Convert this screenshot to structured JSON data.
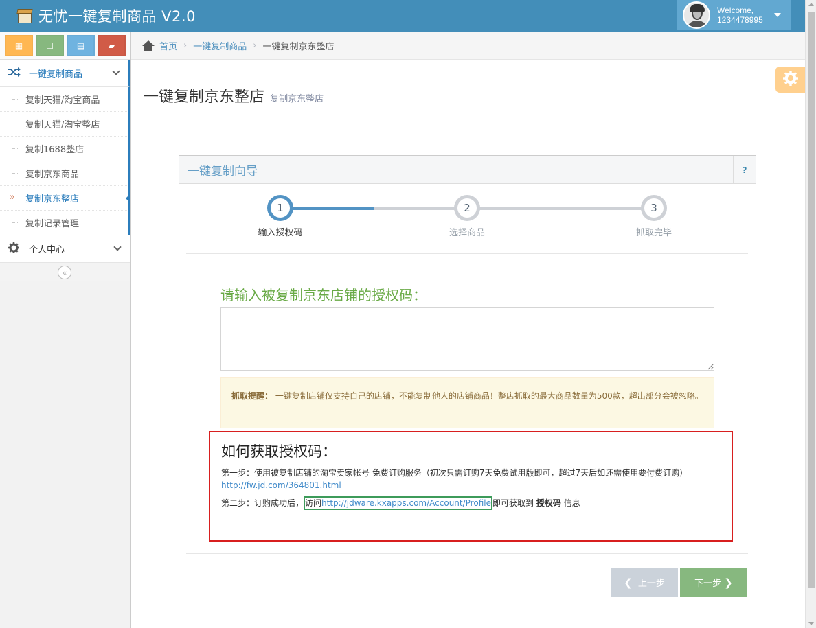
{
  "app": {
    "title": "无忧一键复制商品 V2.0",
    "welcome": "Welcome,",
    "username": "1234478995"
  },
  "shortcuts": [
    {
      "icon": "calendar-icon",
      "color": "#ffb752",
      "glyph": "▦"
    },
    {
      "icon": "square-icon",
      "color": "#87b87f",
      "glyph": "☐"
    },
    {
      "icon": "table-icon",
      "color": "#6fb3e0",
      "glyph": "▤"
    },
    {
      "icon": "book-icon",
      "color": "#d15b47",
      "glyph": "▰"
    }
  ],
  "sidebar": {
    "main_group": "一键复制商品",
    "items": [
      {
        "label": "复制天猫/淘宝商品"
      },
      {
        "label": "复制天猫/淘宝整店"
      },
      {
        "label": "复制1688整店"
      },
      {
        "label": "复制京东商品"
      },
      {
        "label": "复制京东整店",
        "active": true
      },
      {
        "label": "复制记录管理"
      }
    ],
    "personal_group": "个人中心",
    "collapse_glyph": "«"
  },
  "breadcrumb": {
    "home": "首页",
    "parent": "一键复制商品",
    "current": "一键复制京东整店",
    "sep": "›"
  },
  "page": {
    "title": "一键复制京东整店",
    "subtitle": "复制京东整店"
  },
  "wizard": {
    "title": "一键复制向导",
    "help": "?",
    "steps": [
      {
        "num": "1",
        "label": "输入授权码",
        "active": true
      },
      {
        "num": "2",
        "label": "选择商品",
        "active": false
      },
      {
        "num": "3",
        "label": "抓取完毕",
        "active": false
      }
    ],
    "input_label": "请输入被复制京东店铺的授权码：",
    "textarea_value": "",
    "alert_bold": "抓取提醒：",
    "alert_text": "一键复制店铺仅支持自己的店铺，不能复制他人的店铺商品！整店抓取的最大商品数量为500款，超出部分会被忽略。",
    "howto_title": "如何获取授权码：",
    "step1_text": "第一步：使用被复制店铺的淘宝卖家帐号 免费订购服务（初次只需订购7天免费试用版即可，超过7天后如还需使用要付费订购）",
    "step1_link": "http://fw.jd.com/364801.html",
    "step2_prefix": "第二步：订购成功后，",
    "step2_visit": "访问",
    "step2_link": "http://jdware.kxapps.com/Account/Profile",
    "step2_mid": "即可获取到",
    "step2_bold": "授权码",
    "step2_suffix": "信息",
    "prev_label": "上一步",
    "next_label": "下一步"
  },
  "colors": {
    "navbar": "#438eb9",
    "accent": "#2b7dbc",
    "success": "#87b87f",
    "warning_bg": "#fcf8e3",
    "highlight_red": "#d81f1f",
    "highlight_green": "#3d9b5a"
  }
}
